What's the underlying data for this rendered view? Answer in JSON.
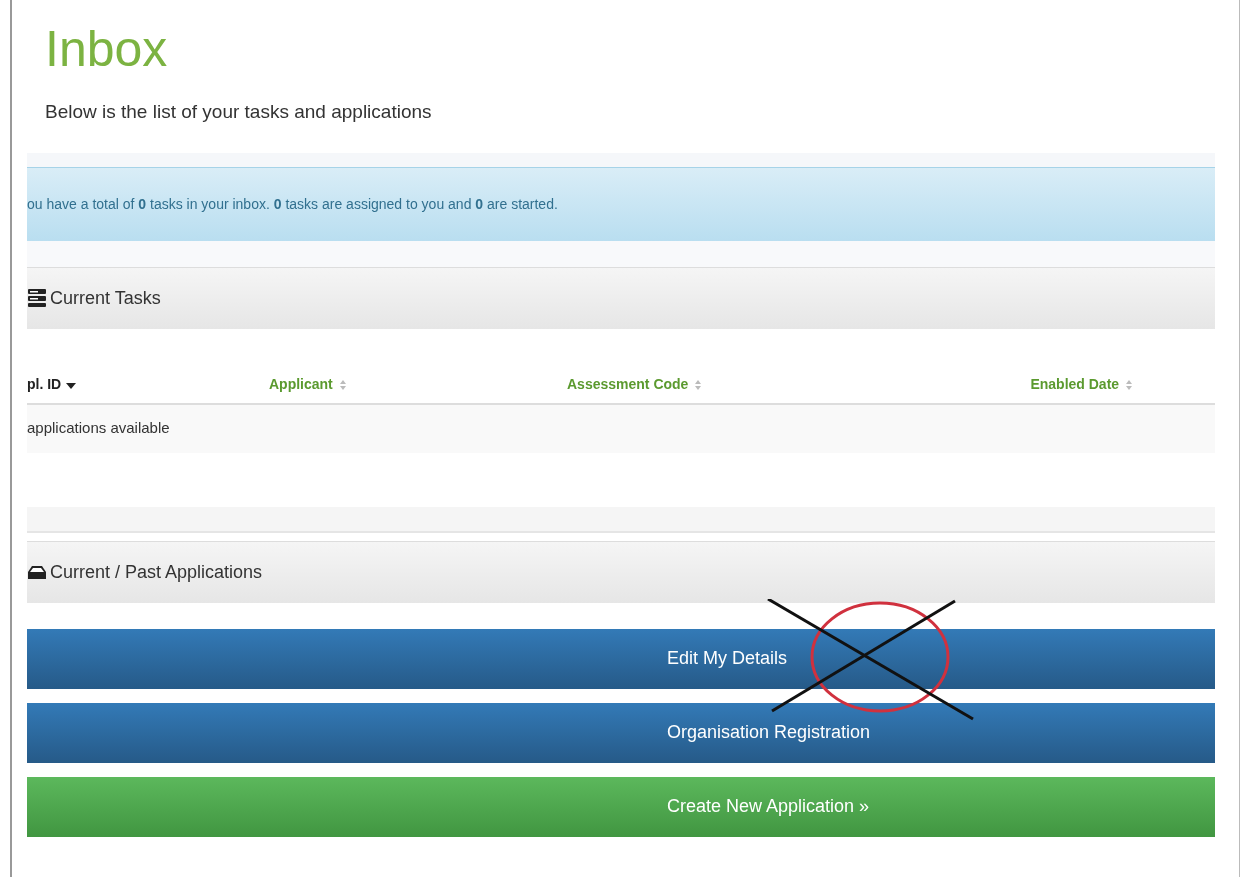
{
  "title": "Inbox",
  "subtitle": "Below is the list of your tasks and applications",
  "info_alert": "ou have a total of **0** tasks in your inbox. **0** tasks are assigned to you and **0** are started.",
  "tasks_panel": {
    "title": "Current Tasks",
    "columns": [
      {
        "label": "pl. ID",
        "sorted": true
      },
      {
        "label": "Applicant",
        "sorted": false
      },
      {
        "label": "Assessment Code",
        "sorted": false
      },
      {
        "label": "Enabled Date",
        "sorted": false
      }
    ],
    "empty_message": "applications available"
  },
  "applications_panel": {
    "title": "Current / Past Applications"
  },
  "buttons": [
    {
      "label": "Edit My Details",
      "kind": "primary"
    },
    {
      "label": "Organisation Registration",
      "kind": "primary"
    },
    {
      "label": "Create New Application »",
      "kind": "success"
    }
  ],
  "annotations": [
    {
      "kind": "ellipse"
    },
    {
      "kind": "cross"
    }
  ]
}
